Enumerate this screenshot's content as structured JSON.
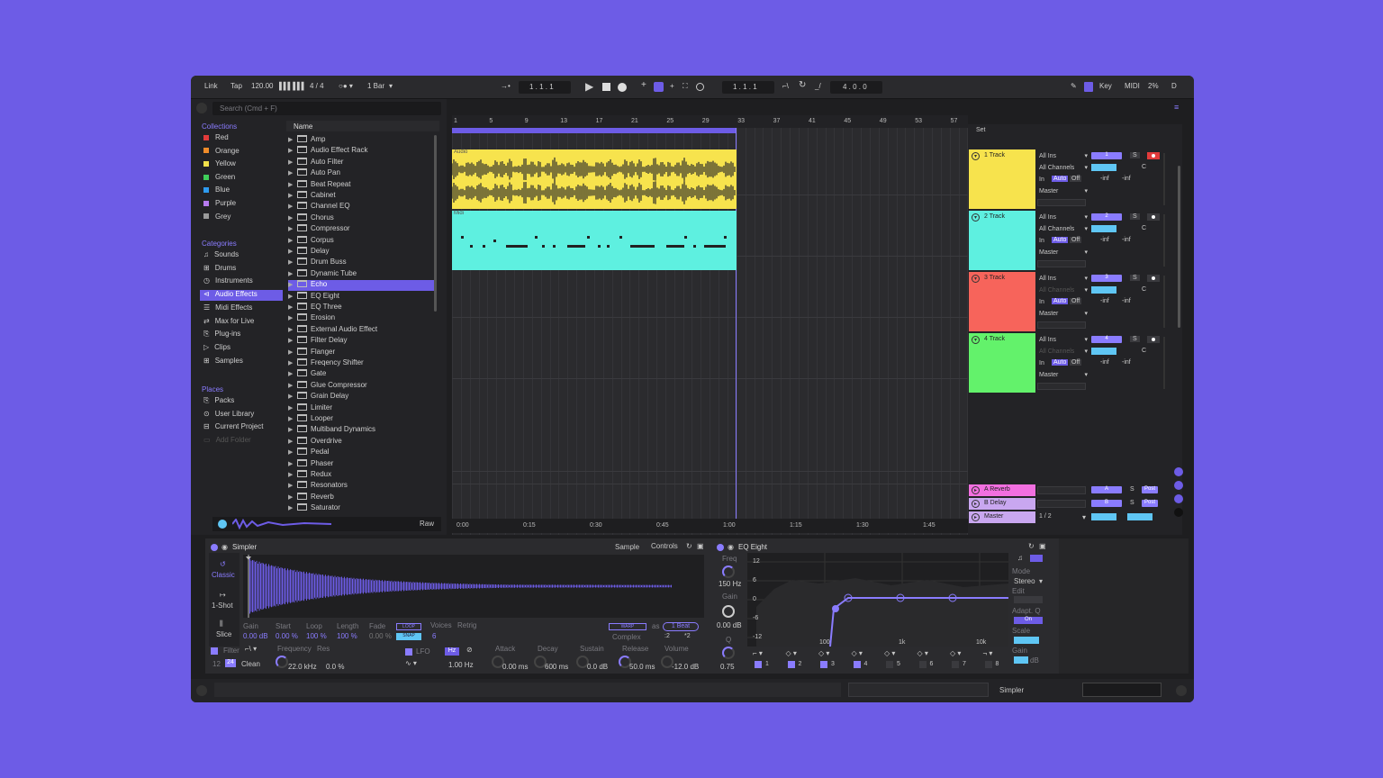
{
  "toolbar": {
    "link": "Link",
    "tap": "Tap",
    "tempo": "120.00",
    "signature": "4 / 4",
    "quantize": "1 Bar",
    "pos1": "1 . 1 . 1",
    "pos2": "1 . 1 . 1",
    "pos3": "4 . 0 . 0",
    "key": "Key",
    "midi": "MIDI",
    "cpu": "2%",
    "d": "D"
  },
  "browser": {
    "search_placeholder": "Search (Cmd + F)",
    "collections_title": "Collections",
    "collections": [
      {
        "label": "Red",
        "color": "#e23b3b"
      },
      {
        "label": "Orange",
        "color": "#f08c2a"
      },
      {
        "label": "Yellow",
        "color": "#f2e14b"
      },
      {
        "label": "Green",
        "color": "#3fce5a"
      },
      {
        "label": "Blue",
        "color": "#2e9bef"
      },
      {
        "label": "Purple",
        "color": "#b77bf0"
      },
      {
        "label": "Grey",
        "color": "#9a9a9a"
      }
    ],
    "categories_title": "Categories",
    "categories": [
      "Sounds",
      "Drums",
      "Instruments",
      "Audio Effects",
      "Midi Effects",
      "Max for Live",
      "Plug-ins",
      "Clips",
      "Samples"
    ],
    "places_title": "Places",
    "places": [
      "Packs",
      "User Library",
      "Current Project",
      "Add Folder"
    ],
    "name_header": "Name",
    "items": [
      "Amp",
      "Audio Effect Rack",
      "Auto Filter",
      "Auto Pan",
      "Beat Repeat",
      "Cabinet",
      "Channel EQ",
      "Chorus",
      "Compressor",
      "Corpus",
      "Delay",
      "Drum Buss",
      "Dynamic Tube",
      "Echo",
      "EQ Eight",
      "EQ Three",
      "Erosion",
      "External Audio Effect",
      "Filter Delay",
      "Flanger",
      "Freqency Shifter",
      "Gate",
      "Glue Compressor",
      "Grain Delay",
      "Limiter",
      "Looper",
      "Multiband Dynamics",
      "Overdrive",
      "Pedal",
      "Phaser",
      "Redux",
      "Resonators",
      "Reverb",
      "Saturator"
    ],
    "selected_item": "Echo",
    "preview_raw": "Raw"
  },
  "arrangement": {
    "ruler": [
      "1",
      "5",
      "9",
      "13",
      "17",
      "21",
      "25",
      "29",
      "33",
      "37",
      "41",
      "45",
      "49",
      "53",
      "57"
    ],
    "time": [
      "0:00",
      "0:15",
      "0:30",
      "0:45",
      "1:00",
      "1:15",
      "1:30",
      "1:45"
    ],
    "clip_audio_label": "Audio",
    "clip_midi_label": "Midi",
    "set_label": "Set"
  },
  "tracks": [
    {
      "name": "1 Track",
      "color": "#f7e34d",
      "num": "1",
      "input": "All Ins",
      "channels": "All Channels",
      "out": "Master"
    },
    {
      "name": "2 Track",
      "color": "#5ef0e0",
      "num": "2",
      "input": "All Ins",
      "channels": "All Channels",
      "out": "Master"
    },
    {
      "name": "3 Track",
      "color": "#f7645b",
      "num": "3",
      "input": "All Ins",
      "channels": "All Channels",
      "out": "Master"
    },
    {
      "name": "4 Track",
      "color": "#63f26b",
      "num": "4",
      "input": "All Ins",
      "channels": "All Channels",
      "out": "Master"
    }
  ],
  "monitor": {
    "in": "In",
    "auto": "Auto",
    "off": "Off",
    "vol1": "-inf",
    "vol2": "-inf",
    "pan": "C",
    "solo": "S"
  },
  "returns": [
    {
      "name": "A Reverb",
      "letter": "A"
    },
    {
      "name": "B Delay",
      "letter": "B"
    }
  ],
  "master": {
    "name": "Master",
    "cue": "1 / 2"
  },
  "post": "Post",
  "simpler": {
    "title": "Simpler",
    "sample": "Sample",
    "controls": "Controls",
    "modes": [
      "Classic",
      "1-Shot",
      "Slice"
    ],
    "params": [
      {
        "l": "Gain",
        "v": "0.00 dB"
      },
      {
        "l": "Start",
        "v": "0.00 %"
      },
      {
        "l": "Loop",
        "v": "100 %"
      },
      {
        "l": "Length",
        "v": "100 %"
      },
      {
        "l": "Fade",
        "v": "0.00 %"
      }
    ],
    "loop": "LOOP",
    "snap": "SNAP",
    "voices": "Voices",
    "voices_val": "6",
    "retrig": "Retrig",
    "warp": "WARP",
    "as": "as",
    "beat": "1 Beat",
    "complex": "Complex",
    "div": ":2",
    "mul": "*2",
    "filter": "Filter",
    "frequency": "Frequency",
    "res": "Res",
    "freq_val": "22.0 kHz",
    "res_val": "0.0 %",
    "clean": "Clean",
    "f12": "12",
    "f24": "24",
    "lfo": "LFO",
    "hz": "Hz",
    "lfo_rate": "1.00 Hz",
    "env": [
      {
        "l": "Attack",
        "v": "0.00 ms"
      },
      {
        "l": "Decay",
        "v": "600 ms"
      },
      {
        "l": "Sustain",
        "v": "0.0 dB"
      },
      {
        "l": "Release",
        "v": "50.0 ms"
      },
      {
        "l": "Volume",
        "v": "-12.0 dB"
      }
    ]
  },
  "eq": {
    "title": "EQ Eight",
    "freq": "Freq",
    "freq_val": "150 Hz",
    "gain": "Gain",
    "gain_val": "0.00 dB",
    "q": "Q",
    "q_val": "0.75",
    "db_ticks": [
      "12",
      "6",
      "0",
      "-6",
      "-12"
    ],
    "hz_ticks": [
      "100",
      "1k",
      "10k"
    ],
    "mode": "Mode",
    "stereo": "Stereo",
    "edit": "Edit",
    "adapt": "Adapt. Q",
    "on": "On",
    "scale": "Scale",
    "gain2": "Gain",
    "db": "dB",
    "bands": [
      "1",
      "2",
      "3",
      "4",
      "5",
      "6",
      "7",
      "8"
    ]
  },
  "status": {
    "device": "Simpler"
  }
}
